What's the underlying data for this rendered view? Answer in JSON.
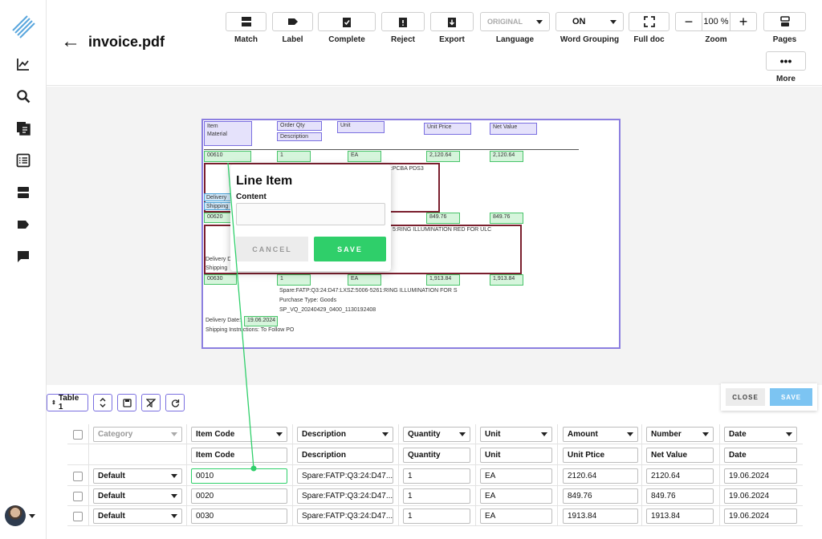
{
  "document": {
    "title": "invoice.pdf"
  },
  "toolbar": {
    "match": "Match",
    "label": "Label",
    "complete": "Complete",
    "reject": "Reject",
    "export": "Export",
    "language_value": "ORIGINAL",
    "language_label": "Language",
    "word_grouping_value": "ON",
    "word_grouping_label": "Word Grouping",
    "full_doc": "Full doc",
    "zoom_value": "100 %",
    "zoom_label": "Zoom",
    "pages": "Pages",
    "more": "More"
  },
  "pdf": {
    "headers": {
      "item": "Item",
      "material": "Material",
      "order_qty": "Order Qty",
      "description": "Description",
      "unit": "Unit",
      "unit_price": "Unit Price",
      "net_value": "Net Value"
    },
    "rows": [
      {
        "item": "00610",
        "qty": "1",
        "unit": "EA",
        "price": "2,120.64",
        "value": "2,120.64",
        "desc_tail": "7:PCBA PDS3"
      },
      {
        "item": "00620",
        "price": "849.76",
        "value": "849.76",
        "desc_tail": "5:RING ILLUMINATION RED FOR ULC"
      },
      {
        "item": "00630",
        "qty": "1",
        "unit": "EA",
        "price": "1,913.84",
        "value": "1,913.84"
      }
    ],
    "delivery_partial_1": "Delivery",
    "shipping_partial_1": "Shipping",
    "delivery_partial_2": "Delivery D",
    "shipping_partial_2": "Shipping",
    "spare_line": "Spare:FATP:Q3:24:D47:LXSZ:5006-5261:RING ILLUMINATION FOR S",
    "purchase_type": "Purchase Type: Goods",
    "sp_line": "SP_VQ_20240429_0400_1130192408",
    "delivery_date_label": "Delivery Date:",
    "delivery_date_value": "19.06.2024",
    "shipping_instructions": "Shipping Instructions: To Follow PO"
  },
  "popup": {
    "title": "Line Item",
    "content_label": "Content",
    "cancel": "CANCEL",
    "save": "SAVE"
  },
  "table_toolbar": {
    "table_select": "Table 1"
  },
  "panel_actions": {
    "close": "CLOSE",
    "save": "SAVE"
  },
  "table": {
    "header_selects": [
      "Category",
      "Item Code",
      "Description",
      "Quantity",
      "Unit",
      "Amount",
      "Number",
      "Date"
    ],
    "header_labels": [
      "Item Code",
      "Description",
      "Quantity",
      "Unit",
      "Unit Ptice",
      "Net Value",
      "Date"
    ],
    "rows": [
      {
        "category": "Default",
        "item_code": "0010",
        "description": "Spare:FATP:Q3:24:D47...",
        "quantity": "1",
        "unit": "EA",
        "amount": "2120.64",
        "number": "2120.64",
        "date": "19.06.2024"
      },
      {
        "category": "Default",
        "item_code": "0020",
        "description": "Spare:FATP:Q3:24:D47...",
        "quantity": "1",
        "unit": "EA",
        "amount": "849.76",
        "number": "849.76",
        "date": "19.06.2024"
      },
      {
        "category": "Default",
        "item_code": "0030",
        "description": "Spare:FATP:Q3:24:D47...",
        "quantity": "1",
        "unit": "EA",
        "amount": "1913.84",
        "number": "1913.84",
        "date": "19.06.2024"
      }
    ]
  },
  "colors": {
    "accent_purple": "#7a6fe0",
    "green": "#2fcf6a",
    "dark_red": "#7b1f2e",
    "save_blue": "#7cc4f2"
  }
}
